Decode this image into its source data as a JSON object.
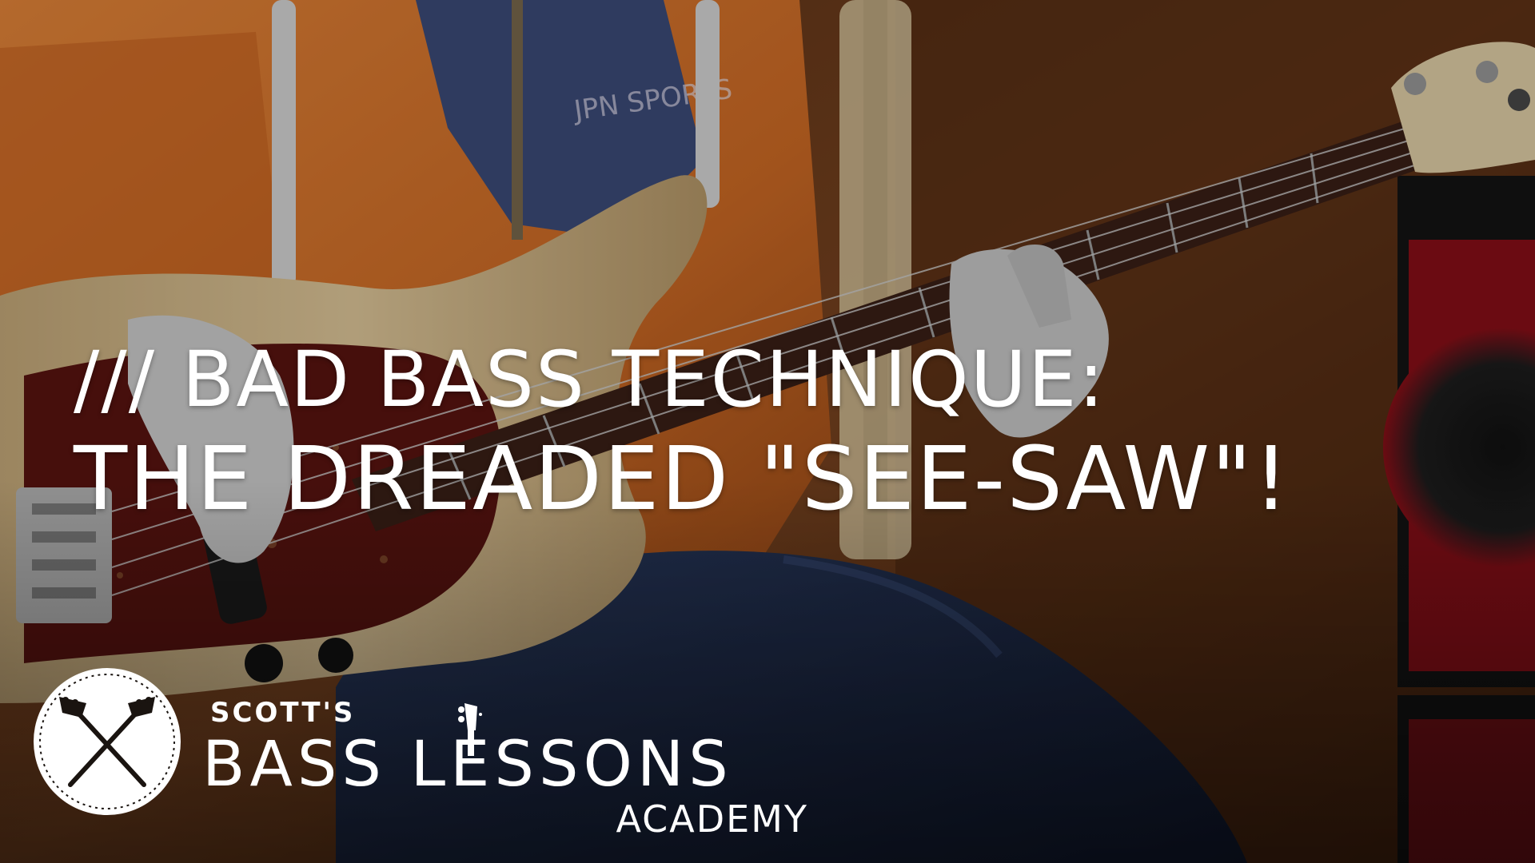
{
  "title": {
    "line1": "/// BAD BASS TECHNIQUE:",
    "line2": "THE DREADED \"SEE-SAW\"!"
  },
  "logo": {
    "top": "SCOTT'S",
    "main": "BASS LESSONS",
    "sub": "ACADEMY"
  },
  "icons": {
    "badge": "crossed-bass-headstocks-icon",
    "neck": "bass-headstock-icon"
  },
  "colors": {
    "text": "#ffffff",
    "hoodie": "#d9772e",
    "jeans": "#1f2d4a",
    "wood": "#6b3a1c",
    "pickguard": "#5a1410",
    "amp_red": "#b3121f"
  }
}
